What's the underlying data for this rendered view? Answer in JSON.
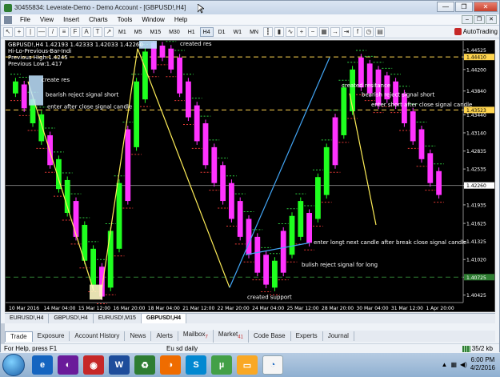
{
  "window": {
    "title": "30455834: Leverate-Demo - Demo Account - [GBPUSD!,H4]",
    "controls": [
      "—",
      "❐",
      "✕"
    ]
  },
  "menu": {
    "items": [
      "File",
      "View",
      "Insert",
      "Charts",
      "Tools",
      "Window",
      "Help"
    ]
  },
  "toolbar": {
    "timeframes": [
      "M1",
      "M5",
      "M15",
      "M30",
      "H1",
      "H4",
      "D1",
      "W1",
      "MN"
    ],
    "active_timeframe": "H4",
    "autotrading_label": "AutoTrading"
  },
  "chart": {
    "info_line1": "GBPUSD!,H4  1.42193 1.42333 1.42033 1.42260",
    "info_line2": "Hi-Lo-Previous-Bar-Indi",
    "info_line3": "Previous High:1.4245",
    "info_line4": "Previous  Low:1.417",
    "price_labels": [
      "1.44525",
      "1.44410",
      "1.44200",
      "1.43840",
      "1.43523",
      "1.43440",
      "1.43140",
      "1.42835",
      "1.42535",
      "1.42260",
      "1.41935",
      "1.41625",
      "1.41325",
      "1.41020",
      "1.40725",
      "1.40425"
    ],
    "highlight_prices": {
      "top": "1.44410",
      "mid": "1.43523",
      "current": "1.42260",
      "bottom": "1.40725"
    },
    "time_labels": [
      "10 Mar 2016",
      "14 Mar 04:00",
      "15 Mar 12:00",
      "16 Mar 20:00",
      "18 Mar 04:00",
      "21 Mar 12:00",
      "22 Mar 20:00",
      "24 Mar 04:00",
      "25 Mar 12:00",
      "28 Mar 20:00",
      "30 Mar 04:00",
      "31 Mar 12:00",
      "1 Apr 20:00"
    ],
    "annotations": {
      "created_res_top": "created res",
      "created_res_left": "create res",
      "bearish_left": "bearish reject signal short",
      "enter_short_left": "enter after close signal candle",
      "created_resistance": "created resitance",
      "bearish_right": "bearish reject signal short",
      "enter_short_right": "enter short after close signal candle",
      "enter_long": "enter longt next candle after break close signal candle",
      "bullish": "bulish  reject signal for long",
      "created_support": "created support"
    }
  },
  "chart_tabs": [
    "EURUSD!,H4",
    "GBPUSD!,H4",
    "EURUSD!,M15",
    "GBPUSD!,H4"
  ],
  "terminal_tabs": [
    {
      "label": "Trade",
      "badge": ""
    },
    {
      "label": "Exposure",
      "badge": ""
    },
    {
      "label": "Account History",
      "badge": ""
    },
    {
      "label": "News",
      "badge": ""
    },
    {
      "label": "Alerts",
      "badge": ""
    },
    {
      "label": "Mailbox",
      "badge": "7"
    },
    {
      "label": "Market",
      "badge": "41"
    },
    {
      "label": "Code Base",
      "badge": ""
    },
    {
      "label": "Experts",
      "badge": ""
    },
    {
      "label": "Journal",
      "badge": ""
    }
  ],
  "status": {
    "help": "For Help, press F1",
    "profile": "Eu sd daily",
    "traffic": "35/2 kb"
  },
  "taskbar": {
    "time": "6:00 PM",
    "date": "4/2/2016",
    "apps": [
      "ie-icon",
      "firefox-icon",
      "chrome-icon",
      "word-icon",
      "recycle-icon",
      "firefox2-icon",
      "skype-icon",
      "torrent-icon",
      "folder-icon",
      "mt4-icon"
    ]
  }
}
